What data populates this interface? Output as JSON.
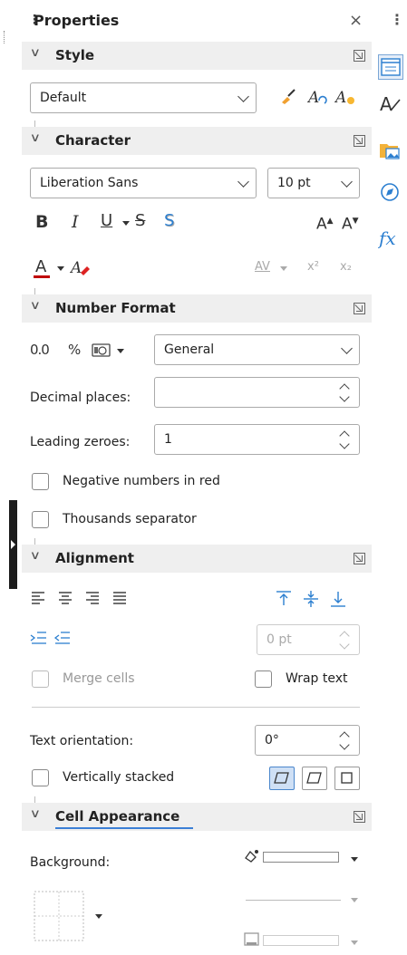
{
  "panel": {
    "title": "Properties"
  },
  "sections": {
    "style": "Style",
    "character": "Character",
    "number_format": "Number Format",
    "alignment": "Alignment",
    "cell_appearance": "Cell Appearance"
  },
  "style": {
    "selected": "Default"
  },
  "character": {
    "font_name": "Liberation Sans",
    "font_size": "10 pt",
    "bold": "B",
    "italic": "I",
    "underline": "U",
    "strike": "S",
    "shadow": "S",
    "grow": "A",
    "shrink": "A",
    "font_color": "A",
    "spacing": "AV",
    "superscript": "x²",
    "subscript": "x₂"
  },
  "number_format": {
    "number_glyph": "0.0",
    "percent_glyph": "%",
    "category": "General",
    "decimal_places_label": "Decimal places:",
    "decimal_places_value": "",
    "leading_zeroes_label": "Leading zeroes:",
    "leading_zeroes_value": "1",
    "negative_red_label": "Negative numbers in red",
    "thousands_label": "Thousands separator"
  },
  "alignment": {
    "indent_value": "0 pt",
    "merge_label": "Merge cells",
    "wrap_label": "Wrap text",
    "orientation_label": "Text orientation:",
    "orientation_value": "0°",
    "stacked_label": "Vertically stacked"
  },
  "cell_appearance": {
    "background_label": "Background:"
  },
  "colors": {
    "accent": "#3b7fd6",
    "font_color_bar": "#c00000",
    "highlight": "#cfe0f5"
  }
}
